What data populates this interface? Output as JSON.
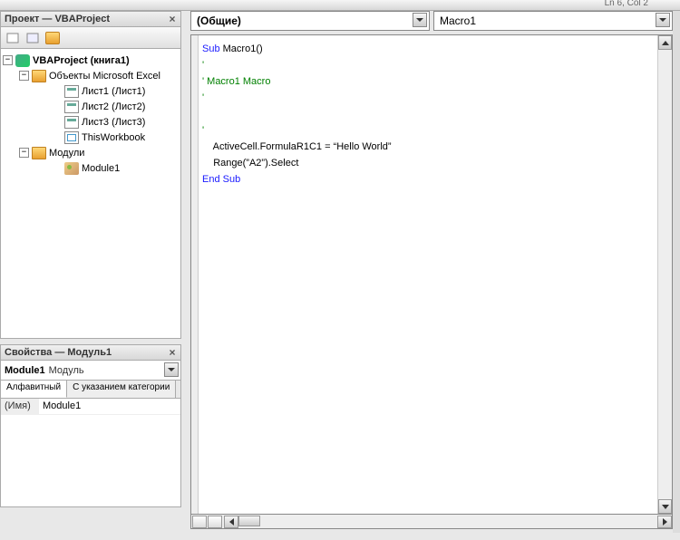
{
  "status": {
    "cursor_pos": "Ln 6, Col 2"
  },
  "project_panel": {
    "title": "Проект — VBAProject",
    "root": "VBAProject (книга1)",
    "folder_objects": "Объекты Microsoft Excel",
    "sheets": [
      "Лист1 (Лист1)",
      "Лист2 (Лист2)",
      "Лист3 (Лист3)"
    ],
    "thisworkbook": "ThisWorkbook",
    "folder_modules": "Модули",
    "module1": "Module1"
  },
  "props_panel": {
    "title": "Свойства — Модуль1",
    "combo_name": "Module1",
    "combo_type": "Модуль",
    "tab_alpha": "Алфавитный",
    "tab_cat": "С указанием категории",
    "row_key": "(Имя)",
    "row_val": "Module1"
  },
  "code": {
    "object_combo": "(Общие)",
    "proc_combo": "Macro1",
    "line1_a": "Sub",
    "line1_b": " Macro1()",
    "line2": "'",
    "line3": "' Macro1 Macro",
    "line4": "'",
    "line5": "",
    "line6": "'",
    "line7": "    ActiveCell.FormulaR1C1 = “Hello World”",
    "line8": "    Range(”A2”).Select",
    "line9": "End Sub"
  }
}
